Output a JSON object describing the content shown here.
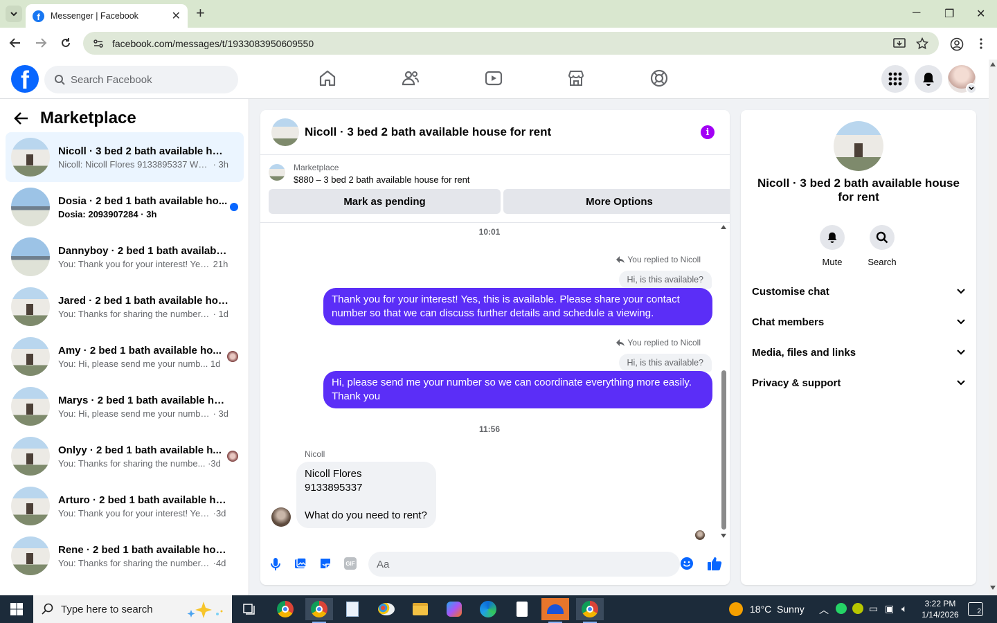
{
  "browser": {
    "tab_title": "Messenger | Facebook",
    "url": "facebook.com/messages/t/1933083950609550"
  },
  "fb": {
    "search_placeholder": "Search Facebook"
  },
  "left": {
    "title": "Marketplace",
    "conversations": [
      {
        "name": "Nicoll · 3 bed 2 bath available hou...",
        "preview": "Nicoll: Nicoll Flores 9133895337 What...",
        "time": "3h",
        "active": true
      },
      {
        "name": "Dosia · 2 bed 1 bath available ho...",
        "preview": "Dosia: 2093907284",
        "time": "3h",
        "unread": true
      },
      {
        "name": "Dannyboy · 2 bed 1 bath available ...",
        "preview": "You: Thank you for your interest! Yes,...",
        "time": "21h"
      },
      {
        "name": "Jared · 2 bed 1 bath available hous...",
        "preview": "You: Thanks for sharing the number. I ...",
        "time": "1d"
      },
      {
        "name": "Amy · 2 bed 1 bath available ho...",
        "preview": "You: Hi, please send me your numb...",
        "time": "1d"
      },
      {
        "name": "Marys · 2 bed 1 bath available hou...",
        "preview": "You: Hi, please send me your number ...",
        "time": "3d"
      },
      {
        "name": "Onlyy · 2 bed 1 bath available h...",
        "preview": "You: Thanks for sharing the numbe...",
        "time": "3d"
      },
      {
        "name": "Arturo · 2 bed 1 bath available hou...",
        "preview": "You: Thank you for your interest! Yes, t...",
        "time": "3d"
      },
      {
        "name": "Rene · 2 bed 1 bath available hous...",
        "preview": "You: Thanks for sharing the number. I ...",
        "time": "4d"
      }
    ]
  },
  "chat": {
    "title": "Nicoll · 3 bed 2 bath available house for rent",
    "listing_label": "Marketplace",
    "listing_detail": "$880 – 3 bed 2 bath available house for rent",
    "mark_pending": "Mark as pending",
    "more_options": "More Options",
    "time1": "10:01",
    "replied_label": "You replied to Nicoll",
    "quoted": "Hi, is this available?",
    "msg1": "Thank you for your interest! Yes, this is available. Please share your contact number so that we can discuss further details and schedule a viewing.",
    "msg2": "Hi, please send me your number so we can coordinate everything more easily. Thank you",
    "time2": "11:56",
    "sender": "Nicoll",
    "incoming": {
      "line1": "Nicoll Flores",
      "line2": "9133895337",
      "line3": "What do you need to rent?"
    },
    "composer_placeholder": "Aa",
    "gif_label": "GIF"
  },
  "info": {
    "name": "Nicoll · 3 bed 2 bath available house for rent",
    "mute": "Mute",
    "search": "Search",
    "sections": [
      "Customise chat",
      "Chat members",
      "Media, files and links",
      "Privacy & support"
    ]
  },
  "taskbar": {
    "search_placeholder": "Type here to search",
    "weather": "18°C  Sunny",
    "time": "3:22 PM",
    "date": "1/14/2026",
    "notifications": "2"
  },
  "colors": {
    "fb_blue": "#0866ff",
    "outgoing_bubble": "#5b2ef7",
    "info_purple": "#a200f5"
  }
}
